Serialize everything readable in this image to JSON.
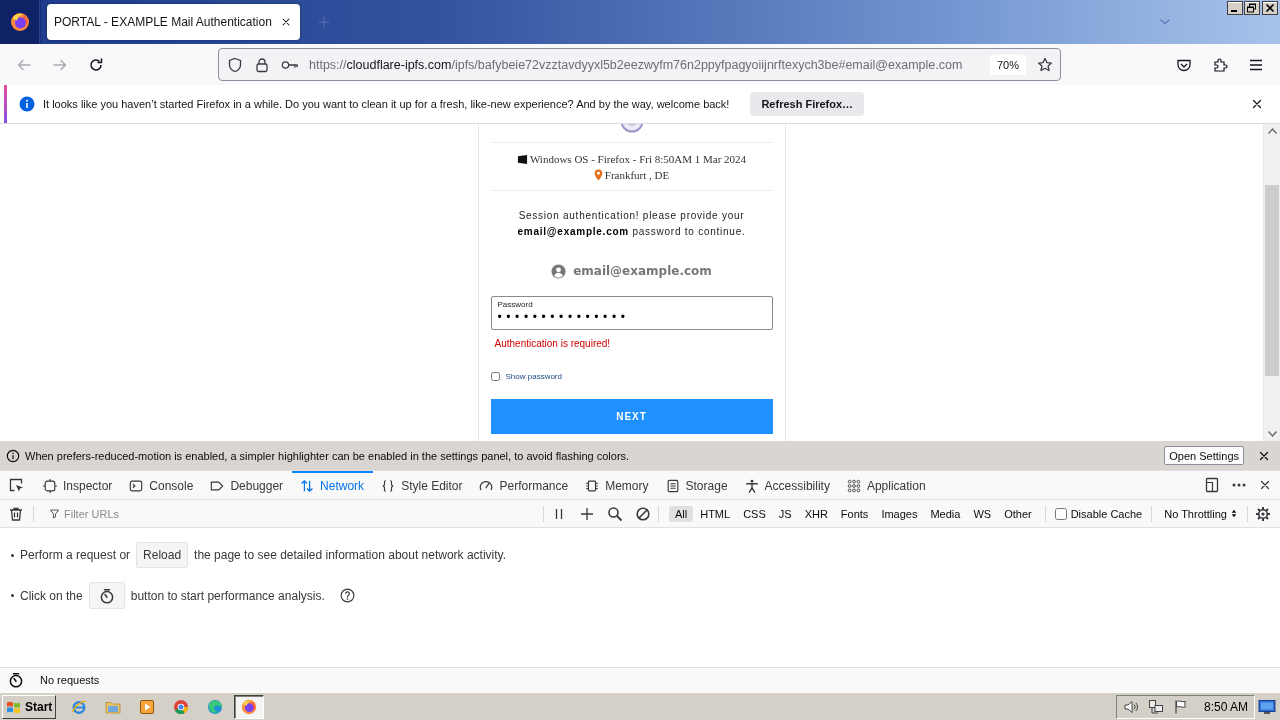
{
  "browser": {
    "tabs": [
      {
        "title": "PORTAL - EXAMPLE Mail Authentication",
        "selected": true
      }
    ],
    "nav_buttons": [
      {
        "kind": "back",
        "disabled": true
      },
      {
        "kind": "forward",
        "disabled": true
      },
      {
        "kind": "reload",
        "disabled": false
      }
    ],
    "address_bar": {
      "scheme": "https://",
      "host": "cloudflare-ipfs.com",
      "path": "/ipfs/bafybeie72vzztavdyyxl5b2eezwyfm76n2ppyfpagyoiijnrftexych3be#email@example.com",
      "zoom": "70%"
    }
  },
  "notification": {
    "text": "It looks like you haven’t started Firefox in a while. Do you want to clean it up for a fresh, like-new experience? And by the way, welcome back!",
    "button": "Refresh Firefox…"
  },
  "page": {
    "device": "Windows OS - Firefox - Fri 8:50AM 1 Mar 2024",
    "location": "Frankfurt , DE",
    "message": "Session authentication! please provide your **email@example.com** password to continue.",
    "account": "email@example.com",
    "password": {
      "label": "Password",
      "value": "•••••••••••••••"
    },
    "error": "Authentication is required!",
    "show_password": {
      "label": "Show password",
      "checked": false
    },
    "button": "NEXT"
  },
  "devtools": {
    "notice": {
      "text": "When prefers-reduced-motion is enabled, a simpler highlighter can be enabled in the settings panel, to avoid flashing colors.",
      "button": "Open Settings"
    },
    "tabs": [
      {
        "label": "Inspector",
        "kind": "inspector",
        "selected": false
      },
      {
        "label": "Console",
        "kind": "console",
        "selected": false
      },
      {
        "label": "Debugger",
        "kind": "debugger",
        "selected": false
      },
      {
        "label": "Network",
        "kind": "network",
        "selected": true
      },
      {
        "label": "Style Editor",
        "kind": "style-editor",
        "selected": false
      },
      {
        "label": "Performance",
        "kind": "performance",
        "selected": false
      },
      {
        "label": "Memory",
        "kind": "memory",
        "selected": false
      },
      {
        "label": "Storage",
        "kind": "storage",
        "selected": false
      },
      {
        "label": "Accessibility",
        "kind": "accessibility",
        "selected": false
      },
      {
        "label": "Application",
        "kind": "application",
        "selected": false
      }
    ],
    "filter": {
      "placeholder": "Filter URLs"
    },
    "type_filters": [
      {
        "label": "All",
        "selected": true
      },
      {
        "label": "HTML",
        "selected": false
      },
      {
        "label": "CSS",
        "selected": false
      },
      {
        "label": "JS",
        "selected": false
      },
      {
        "label": "XHR",
        "selected": false
      },
      {
        "label": "Fonts",
        "selected": false
      },
      {
        "label": "Images",
        "selected": false
      },
      {
        "label": "Media",
        "selected": false
      },
      {
        "label": "WS",
        "selected": false
      },
      {
        "label": "Other",
        "selected": false
      }
    ],
    "disable_cache": {
      "label": "Disable Cache",
      "checked": false
    },
    "throttling": "No Throttling",
    "hints": [
      {
        "kind": "reload",
        "before": "Perform a request or",
        "button": "Reload",
        "after": "the page to see detailed information about network activity."
      },
      {
        "kind": "performance",
        "before": "Click on the",
        "after": "button to start performance analysis."
      }
    ],
    "status": "No requests"
  },
  "taskbar": {
    "start": "Start",
    "apps": [
      {
        "kind": "ie",
        "selected": false
      },
      {
        "kind": "folder",
        "selected": false
      },
      {
        "kind": "media",
        "selected": false
      },
      {
        "kind": "chrome",
        "selected": false
      },
      {
        "kind": "edge",
        "selected": false
      },
      {
        "kind": "firefox",
        "selected": true
      }
    ],
    "clock": "8:50 AM"
  }
}
